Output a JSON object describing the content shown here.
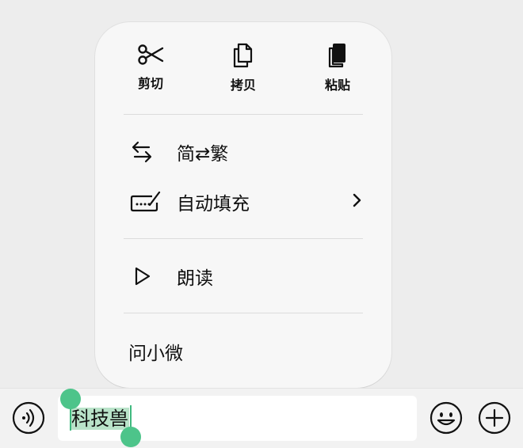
{
  "menu": {
    "top_actions": [
      {
        "label": "剪切",
        "icon": "scissors-icon"
      },
      {
        "label": "拷贝",
        "icon": "copy-icon"
      },
      {
        "label": "粘贴",
        "icon": "paste-icon"
      }
    ],
    "items": [
      {
        "label": "简⇄繁",
        "icon": "swap-arrows-icon"
      },
      {
        "label": "自动填充",
        "icon": "keyboard-pen-icon"
      },
      {
        "label": "朗读",
        "icon": "play-icon"
      },
      {
        "label": "问小微"
      }
    ]
  },
  "input": {
    "text": "科技兽"
  },
  "colors": {
    "selection": "#b9e3c9",
    "handle": "#4dc48a",
    "menu_bg": "#f7f7f7",
    "page_bg": "#ededed"
  }
}
